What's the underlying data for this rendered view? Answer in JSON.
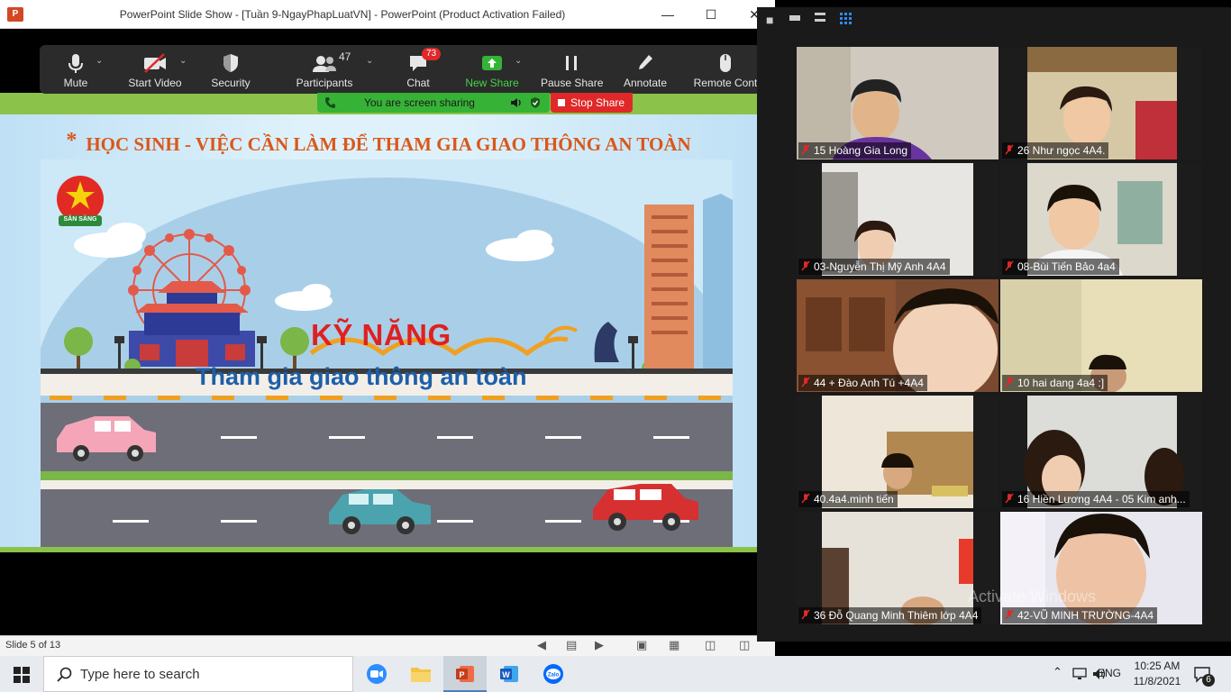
{
  "ppt": {
    "title": "PowerPoint Slide Show - [Tuần 9-NgayPhapLuatVN] - PowerPoint (Product Activation Failed)",
    "app_icon": "P"
  },
  "zoom_toolbar": {
    "mute": "Mute",
    "start_video": "Start Video",
    "security": "Security",
    "participants": "Participants",
    "participants_count": "47",
    "chat": "Chat",
    "chat_badge": "73",
    "new_share": "New Share",
    "pause_share": "Pause Share",
    "annotate": "Annotate",
    "remote_control": "Remote Cont"
  },
  "share_banner": {
    "text": "You are screen sharing",
    "stop": "Stop Share"
  },
  "slide": {
    "heading": "HỌC SINH - VIỆC CẦN LÀM ĐỂ THAM GIA GIAO THÔNG AN TOÀN",
    "bullet": "*",
    "title_main": "KỸ NĂNG",
    "title_sub": "Tham gia giao thông an toàn",
    "logo_text": "SẴN SÀNG"
  },
  "statusbar": {
    "slide_info": "Slide 5 of 13"
  },
  "gallery": {
    "tiles": [
      {
        "name": "15 Hoàng Gia Long"
      },
      {
        "name": "26 Như ngọc 4A4."
      },
      {
        "name": "03-Nguyễn Thị Mỹ Anh 4A4"
      },
      {
        "name": "08-Bùi Tiến Bảo 4a4"
      },
      {
        "name": "44 + Đào Anh Tú +4A4"
      },
      {
        "name": "10 hai dang 4a4 :]"
      },
      {
        "name": "40.4a4.minh tiến"
      },
      {
        "name": "16 Hiền Lương 4A4 - 05 Kim anh..."
      },
      {
        "name": "36 Đỗ Quang Minh Thiêm lớp 4A4"
      },
      {
        "name": "42-VŨ MINH TRƯỜNG-4A4"
      }
    ],
    "watermark": "Activate Windows"
  },
  "taskbar": {
    "search_placeholder": "Type here to search",
    "language": "ENG",
    "time": "10:25 AM",
    "date": "11/8/2021",
    "notifications": "6",
    "apps": [
      "zoom-icon",
      "file-explorer-icon",
      "powerpoint-icon",
      "word-icon",
      "zalo-icon"
    ]
  },
  "colors": {
    "slide_heading": "#d9581a",
    "zoom_toolbar_bg": "#2b2b2b",
    "share_green": "#36b336",
    "stop_red": "#e02828",
    "slide_green": "#8bc34a"
  }
}
